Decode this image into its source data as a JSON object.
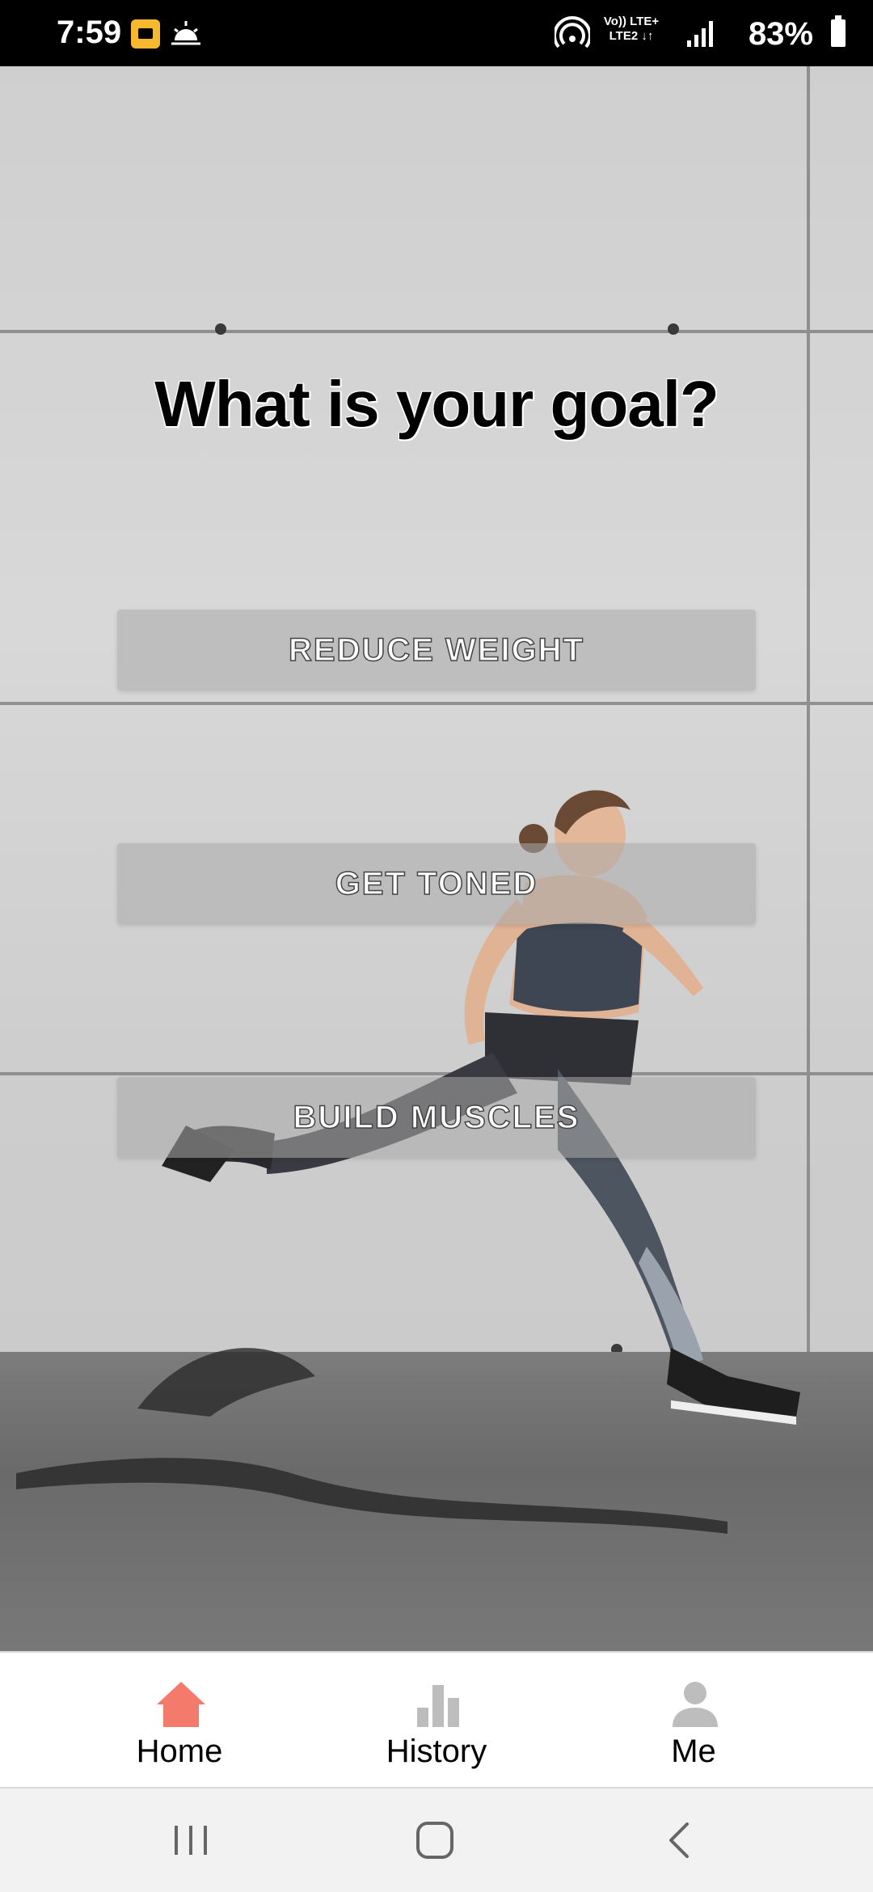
{
  "status_bar": {
    "time": "7:59",
    "network_line1": "Vo)) LTE+",
    "network_line2": "LTE2 ↓↑",
    "battery": "83%"
  },
  "main": {
    "title": "What is your goal?",
    "goals": [
      {
        "label": "REDUCE WEIGHT"
      },
      {
        "label": "GET TONED"
      },
      {
        "label": "BUILD MUSCLES"
      }
    ]
  },
  "bottom_nav": {
    "items": [
      {
        "label": "Home",
        "icon": "home-icon",
        "active": true
      },
      {
        "label": "History",
        "icon": "bar-chart-icon",
        "active": false
      },
      {
        "label": "Me",
        "icon": "person-icon",
        "active": false
      }
    ]
  },
  "colors": {
    "accent": "#f47b6b",
    "inactive_icon": "#bdbdbd"
  }
}
